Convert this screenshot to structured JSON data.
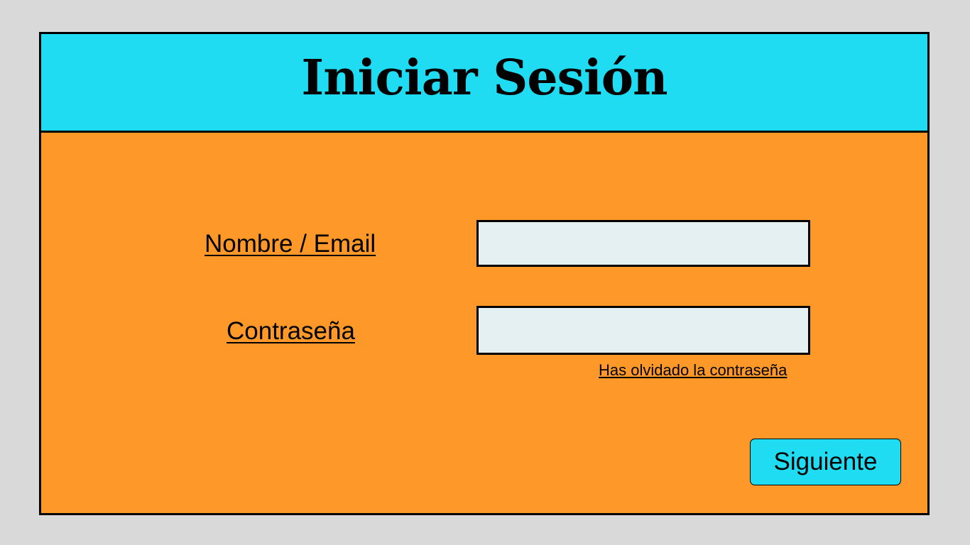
{
  "header": {
    "title": "Iniciar Sesión"
  },
  "form": {
    "username_label": "Nombre / Email",
    "username_value": "",
    "password_label": "Contraseña",
    "password_value": "",
    "forgot_password_link": "Has olvidado la contraseña",
    "next_button_label": "Siguiente"
  },
  "colors": {
    "page_background": "#d9d9d9",
    "header_background": "#1fdcf3",
    "panel_background": "#fe9929",
    "input_background": "#e4f0f1",
    "button_background": "#1fdcf3"
  }
}
